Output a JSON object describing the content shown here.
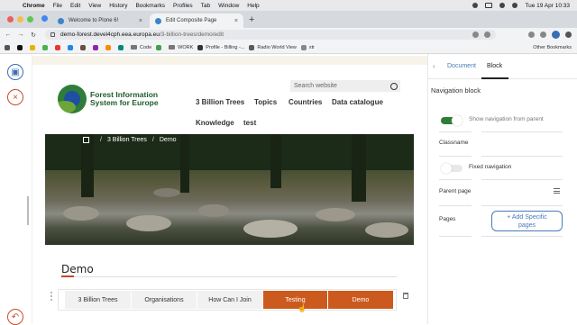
{
  "menubar": {
    "app": "Chrome",
    "items": [
      "File",
      "Edit",
      "View",
      "History",
      "Bookmarks",
      "Profiles",
      "Tab",
      "Window",
      "Help"
    ],
    "clock": "Tue 19 Apr  10:33"
  },
  "tabs": [
    {
      "title": "Welcome to Plone 6!",
      "active": false
    },
    {
      "title": "Edit Composite Page",
      "active": true
    }
  ],
  "address": {
    "host": "demo-forest.devel4cph.eea.europa.eu",
    "path": "/3-billion-trees/demo/edit"
  },
  "bookmarks": {
    "items": [
      "Code",
      "WORK",
      "Profile - Billing -...",
      "Radio World View",
      "xtr"
    ],
    "other": "Other Bookmarks"
  },
  "site": {
    "logo_line1": "Forest Information",
    "logo_line2": "System for Europe",
    "search_placeholder": "Search website",
    "nav": [
      "3 Billion Trees",
      "Topics",
      "Countries",
      "Data catalogue",
      "Knowledge",
      "test"
    ]
  },
  "breadcrumb": [
    "3 Billion Trees",
    "Demo"
  ],
  "page": {
    "title": "Demo",
    "tabs": [
      {
        "label": "3 Billion Trees",
        "active": false
      },
      {
        "label": "Organisations",
        "active": false
      },
      {
        "label": "How Can I Join",
        "active": false
      },
      {
        "label": "Testing",
        "active": true
      },
      {
        "label": "Demo",
        "active": true
      }
    ]
  },
  "sidebar": {
    "tabs": [
      "Document",
      "Block"
    ],
    "active_tab": "Block",
    "section": "Navigation block",
    "show_nav_label": "Show navigation from parent",
    "show_nav_on": true,
    "classname_label": "Classname",
    "fixed_nav_label": "Fixed navigation",
    "fixed_nav_on": false,
    "parent_page_label": "Parent page",
    "pages_label": "Pages",
    "add_pages_line1": "+ Add Specific",
    "add_pages_line2": "pages"
  },
  "colors": {
    "accent": "#cc5a1e",
    "toggle_on": "#2f7d3a",
    "link_blue": "#4a79b8"
  }
}
